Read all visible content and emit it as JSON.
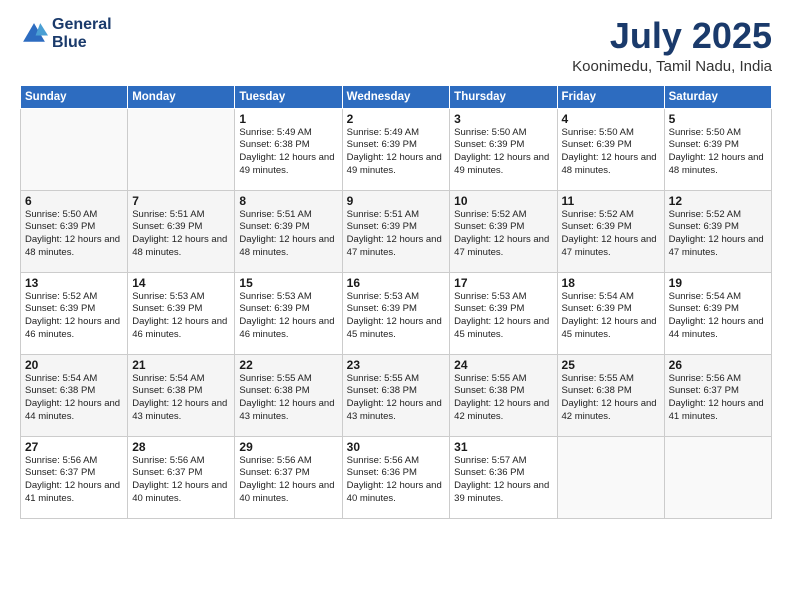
{
  "header": {
    "logo_line1": "General",
    "logo_line2": "Blue",
    "month_title": "July 2025",
    "location": "Koonimedu, Tamil Nadu, India"
  },
  "calendar": {
    "days_of_week": [
      "Sunday",
      "Monday",
      "Tuesday",
      "Wednesday",
      "Thursday",
      "Friday",
      "Saturday"
    ],
    "weeks": [
      [
        {
          "day": "",
          "info": ""
        },
        {
          "day": "",
          "info": ""
        },
        {
          "day": "1",
          "info": "Sunrise: 5:49 AM\nSunset: 6:38 PM\nDaylight: 12 hours and 49 minutes."
        },
        {
          "day": "2",
          "info": "Sunrise: 5:49 AM\nSunset: 6:39 PM\nDaylight: 12 hours and 49 minutes."
        },
        {
          "day": "3",
          "info": "Sunrise: 5:50 AM\nSunset: 6:39 PM\nDaylight: 12 hours and 49 minutes."
        },
        {
          "day": "4",
          "info": "Sunrise: 5:50 AM\nSunset: 6:39 PM\nDaylight: 12 hours and 48 minutes."
        },
        {
          "day": "5",
          "info": "Sunrise: 5:50 AM\nSunset: 6:39 PM\nDaylight: 12 hours and 48 minutes."
        }
      ],
      [
        {
          "day": "6",
          "info": "Sunrise: 5:50 AM\nSunset: 6:39 PM\nDaylight: 12 hours and 48 minutes."
        },
        {
          "day": "7",
          "info": "Sunrise: 5:51 AM\nSunset: 6:39 PM\nDaylight: 12 hours and 48 minutes."
        },
        {
          "day": "8",
          "info": "Sunrise: 5:51 AM\nSunset: 6:39 PM\nDaylight: 12 hours and 48 minutes."
        },
        {
          "day": "9",
          "info": "Sunrise: 5:51 AM\nSunset: 6:39 PM\nDaylight: 12 hours and 47 minutes."
        },
        {
          "day": "10",
          "info": "Sunrise: 5:52 AM\nSunset: 6:39 PM\nDaylight: 12 hours and 47 minutes."
        },
        {
          "day": "11",
          "info": "Sunrise: 5:52 AM\nSunset: 6:39 PM\nDaylight: 12 hours and 47 minutes."
        },
        {
          "day": "12",
          "info": "Sunrise: 5:52 AM\nSunset: 6:39 PM\nDaylight: 12 hours and 47 minutes."
        }
      ],
      [
        {
          "day": "13",
          "info": "Sunrise: 5:52 AM\nSunset: 6:39 PM\nDaylight: 12 hours and 46 minutes."
        },
        {
          "day": "14",
          "info": "Sunrise: 5:53 AM\nSunset: 6:39 PM\nDaylight: 12 hours and 46 minutes."
        },
        {
          "day": "15",
          "info": "Sunrise: 5:53 AM\nSunset: 6:39 PM\nDaylight: 12 hours and 46 minutes."
        },
        {
          "day": "16",
          "info": "Sunrise: 5:53 AM\nSunset: 6:39 PM\nDaylight: 12 hours and 45 minutes."
        },
        {
          "day": "17",
          "info": "Sunrise: 5:53 AM\nSunset: 6:39 PM\nDaylight: 12 hours and 45 minutes."
        },
        {
          "day": "18",
          "info": "Sunrise: 5:54 AM\nSunset: 6:39 PM\nDaylight: 12 hours and 45 minutes."
        },
        {
          "day": "19",
          "info": "Sunrise: 5:54 AM\nSunset: 6:39 PM\nDaylight: 12 hours and 44 minutes."
        }
      ],
      [
        {
          "day": "20",
          "info": "Sunrise: 5:54 AM\nSunset: 6:38 PM\nDaylight: 12 hours and 44 minutes."
        },
        {
          "day": "21",
          "info": "Sunrise: 5:54 AM\nSunset: 6:38 PM\nDaylight: 12 hours and 43 minutes."
        },
        {
          "day": "22",
          "info": "Sunrise: 5:55 AM\nSunset: 6:38 PM\nDaylight: 12 hours and 43 minutes."
        },
        {
          "day": "23",
          "info": "Sunrise: 5:55 AM\nSunset: 6:38 PM\nDaylight: 12 hours and 43 minutes."
        },
        {
          "day": "24",
          "info": "Sunrise: 5:55 AM\nSunset: 6:38 PM\nDaylight: 12 hours and 42 minutes."
        },
        {
          "day": "25",
          "info": "Sunrise: 5:55 AM\nSunset: 6:38 PM\nDaylight: 12 hours and 42 minutes."
        },
        {
          "day": "26",
          "info": "Sunrise: 5:56 AM\nSunset: 6:37 PM\nDaylight: 12 hours and 41 minutes."
        }
      ],
      [
        {
          "day": "27",
          "info": "Sunrise: 5:56 AM\nSunset: 6:37 PM\nDaylight: 12 hours and 41 minutes."
        },
        {
          "day": "28",
          "info": "Sunrise: 5:56 AM\nSunset: 6:37 PM\nDaylight: 12 hours and 40 minutes."
        },
        {
          "day": "29",
          "info": "Sunrise: 5:56 AM\nSunset: 6:37 PM\nDaylight: 12 hours and 40 minutes."
        },
        {
          "day": "30",
          "info": "Sunrise: 5:56 AM\nSunset: 6:36 PM\nDaylight: 12 hours and 40 minutes."
        },
        {
          "day": "31",
          "info": "Sunrise: 5:57 AM\nSunset: 6:36 PM\nDaylight: 12 hours and 39 minutes."
        },
        {
          "day": "",
          "info": ""
        },
        {
          "day": "",
          "info": ""
        }
      ]
    ]
  }
}
